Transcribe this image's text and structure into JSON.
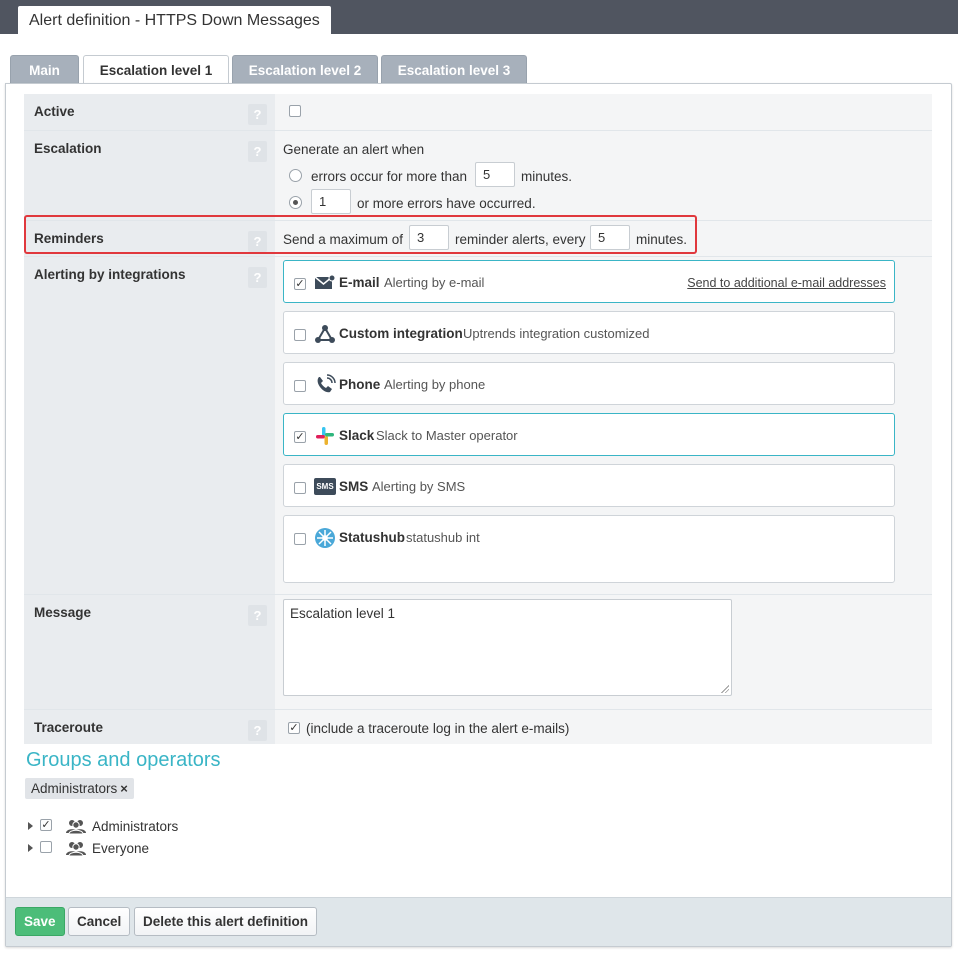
{
  "window": {
    "title": "Alert definition - HTTPS Down Messages"
  },
  "tabs": [
    {
      "label": "Main"
    },
    {
      "label": "Escalation level 1"
    },
    {
      "label": "Escalation level 2"
    },
    {
      "label": "Escalation level 3"
    }
  ],
  "help_glyph": "?",
  "fields": {
    "active": {
      "label": "Active",
      "checked": false
    },
    "escalation": {
      "label": "Escalation",
      "intro": "Generate an alert when",
      "option1_prefix": "errors occur for more than",
      "option1_value": "5",
      "option1_suffix": "minutes.",
      "option2_value": "1",
      "option2_suffix": "or more errors have occurred.",
      "selected": 2
    },
    "reminders": {
      "label": "Reminders",
      "prefix": "Send a maximum of",
      "max_value": "3",
      "middle": "reminder alerts, every",
      "every_value": "5",
      "suffix": "minutes."
    },
    "integrations": {
      "label": "Alerting by integrations",
      "items": [
        {
          "name": "E-mail",
          "description": "Alerting by e-mail",
          "checked": true,
          "icon": "envelope-icon",
          "link": "Send to additional e-mail addresses"
        },
        {
          "name": "Custom integration",
          "description": "Uptrends integration customized",
          "checked": false,
          "icon": "custom-integration-icon"
        },
        {
          "name": "Phone",
          "description": "Alerting by phone",
          "checked": false,
          "icon": "phone-icon"
        },
        {
          "name": "Slack",
          "description": "Slack to Master operator",
          "checked": true,
          "icon": "slack-icon"
        },
        {
          "name": "SMS",
          "description": "Alerting by SMS",
          "checked": false,
          "icon": "sms-icon",
          "icon_text": "SMS"
        },
        {
          "name": "Statushub",
          "description": "statushub int",
          "checked": false,
          "icon": "statushub-icon"
        }
      ]
    },
    "message": {
      "label": "Message",
      "value": "Escalation level 1"
    },
    "traceroute": {
      "label": "Traceroute",
      "checked": true,
      "text": "(include a traceroute log in the alert e-mails)"
    }
  },
  "groups": {
    "title": "Groups and operators",
    "selected_tag": "Administrators",
    "remove_glyph": "×",
    "tree": [
      {
        "label": "Administrators",
        "checked": true
      },
      {
        "label": "Everyone",
        "checked": false
      }
    ]
  },
  "footer": {
    "save": "Save",
    "cancel": "Cancel",
    "delete": "Delete this alert definition"
  },
  "colors": {
    "accent": "#3ab5c6",
    "save_button": "#4cbd79",
    "highlight": "#e0383d",
    "topbar": "#505560",
    "inactive_tab": "#a7b0bb"
  }
}
